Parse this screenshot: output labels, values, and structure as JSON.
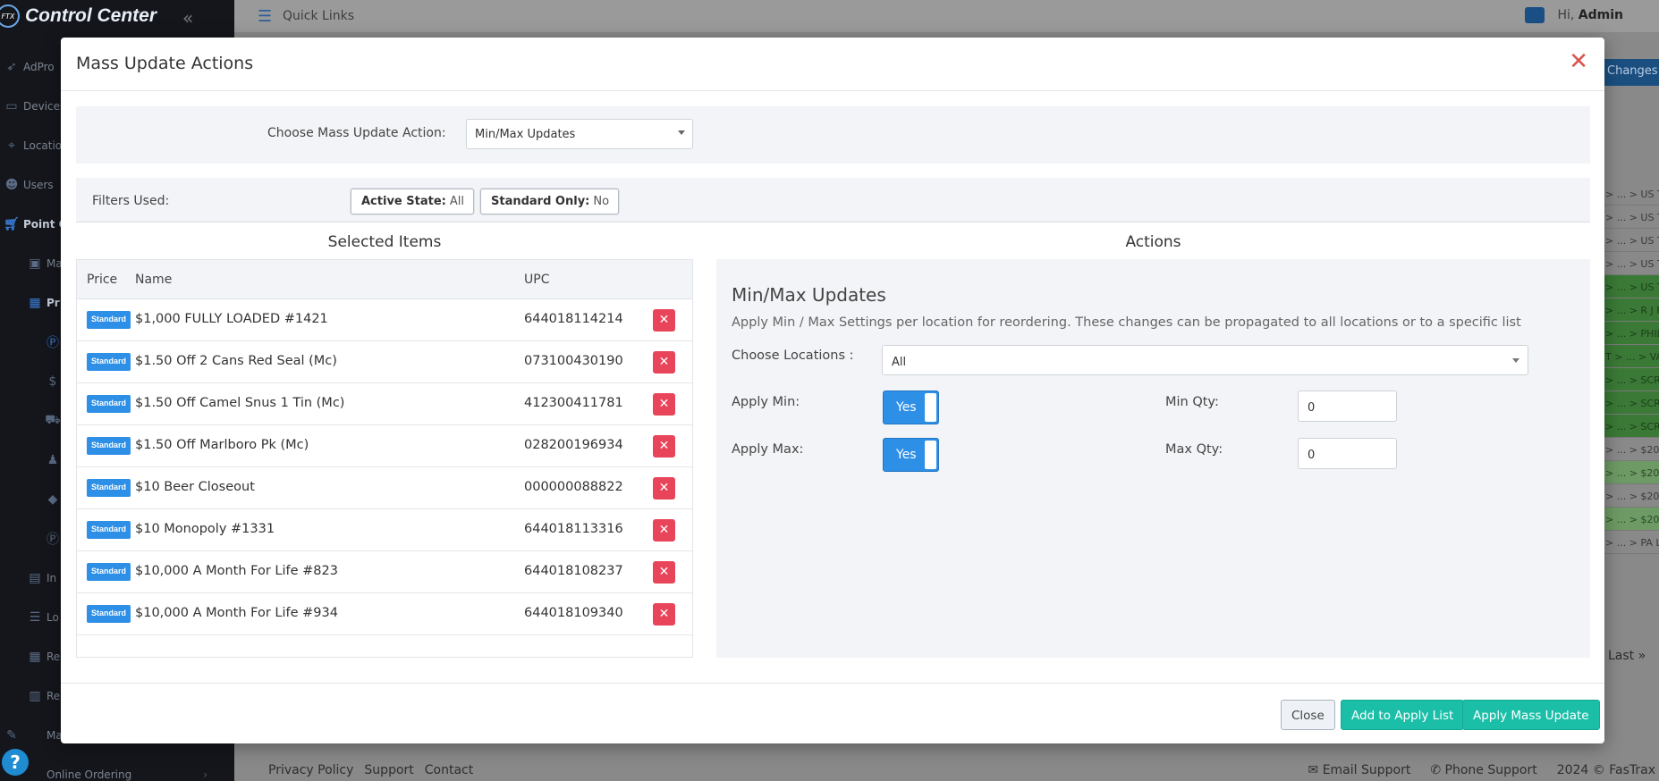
{
  "app": {
    "title": "Control Center",
    "logo_badge": "FTX",
    "user_greeting": "Hi,",
    "user_name": "Admin"
  },
  "sidebar": {
    "items": [
      {
        "label": "AdPro",
        "icon": "rocket-icon"
      },
      {
        "label": "Devices",
        "icon": "devices-icon"
      },
      {
        "label": "Location",
        "icon": "location-icon"
      },
      {
        "label": "Users",
        "icon": "users-icon"
      },
      {
        "label": "Point O",
        "icon": "cart-icon"
      },
      {
        "label": "Ma",
        "icon": "page-icon"
      },
      {
        "label": "Pr",
        "icon": "calculator-icon"
      },
      {
        "label": "",
        "icon": "p-circle-icon"
      },
      {
        "label": "",
        "icon": "dollar-circle-icon"
      },
      {
        "label": "",
        "icon": "truck-icon"
      },
      {
        "label": "",
        "icon": "person-icon"
      },
      {
        "label": "",
        "icon": "tag-icon"
      },
      {
        "label": "",
        "icon": "p-circle-icon"
      },
      {
        "label": "In",
        "icon": "chart-icon"
      },
      {
        "label": "Lo",
        "icon": "list-icon"
      },
      {
        "label": "Re",
        "icon": "grid-icon"
      },
      {
        "label": "Re",
        "icon": "bar-chart-icon"
      },
      {
        "label": "Ma",
        "icon": "wrench-icon"
      },
      {
        "label": "Online Ordering",
        "icon": "globe-icon"
      }
    ]
  },
  "topbar": {
    "quick_links": "Quick Links"
  },
  "background": {
    "changes_button": "Changes",
    "rows": [
      "> ... > US T",
      "> ... > US T",
      "> ... > US T",
      "> ... > US T",
      "> ... > US T",
      "> ... > R J R",
      "> ... > PHIL",
      "T > ... > VA",
      "> ... > SCRA",
      "> ... > SCRA",
      "> ... > SCRA",
      "> ... > $20",
      "> ... > $20",
      "> ... > $20",
      "> ... > $20",
      "> ... > PA L"
    ],
    "last_link": "Last »",
    "footer_links": [
      "Privacy Policy",
      "Support",
      "Contact"
    ],
    "footer_right": [
      "Email Support",
      "Phone Support",
      "2024 © FasTrax"
    ]
  },
  "modal": {
    "title": "Mass Update Actions",
    "action_label": "Choose Mass Update Action:",
    "action_value": "Min/Max Updates",
    "filters_label": "Filters Used:",
    "filters": [
      {
        "key": "Active State:",
        "value": "All"
      },
      {
        "key": "Standard Only:",
        "value": "No"
      }
    ],
    "selected_title": "Selected Items",
    "actions_title": "Actions",
    "columns": {
      "price": "Price",
      "name": "Name",
      "upc": "UPC"
    },
    "items": [
      {
        "badge": "Standard",
        "name": "$1,000 FULLY LOADED #1421",
        "upc": "644018114214"
      },
      {
        "badge": "Standard",
        "name": "$1.50 Off 2 Cans Red Seal (Mc)",
        "upc": "073100430190"
      },
      {
        "badge": "Standard",
        "name": "$1.50 Off Camel Snus 1 Tin (Mc)",
        "upc": "412300411781"
      },
      {
        "badge": "Standard",
        "name": "$1.50 Off Marlboro Pk (Mc)",
        "upc": "028200196934"
      },
      {
        "badge": "Standard",
        "name": "$10 Beer Closeout",
        "upc": "000000088822"
      },
      {
        "badge": "Standard",
        "name": "$10 Monopoly #1331",
        "upc": "644018113316"
      },
      {
        "badge": "Standard",
        "name": "$10,000 A Month For Life #823",
        "upc": "644018108237"
      },
      {
        "badge": "Standard",
        "name": "$10,000 A Month For Life #934",
        "upc": "644018109340"
      }
    ],
    "minmax": {
      "heading": "Min/Max Updates",
      "description": "Apply Min / Max Settings per location for reordering. These changes can be propagated to all locations or to a specific list",
      "locations_label": "Choose Locations :",
      "locations_value": "All",
      "apply_min_label": "Apply Min:",
      "apply_min_value": "Yes",
      "apply_max_label": "Apply Max:",
      "apply_max_value": "Yes",
      "min_qty_label": "Min Qty:",
      "min_qty_value": "0",
      "max_qty_label": "Max Qty:",
      "max_qty_value": "0"
    },
    "buttons": {
      "close": "Close",
      "add_to_apply_list": "Add to Apply List",
      "apply_mass_update": "Apply Mass Update"
    }
  },
  "colors": {
    "primary_blue": "#2e8fe6",
    "teal": "#1bbfa8",
    "danger": "#e8455a",
    "close_x": "#d9534f"
  }
}
